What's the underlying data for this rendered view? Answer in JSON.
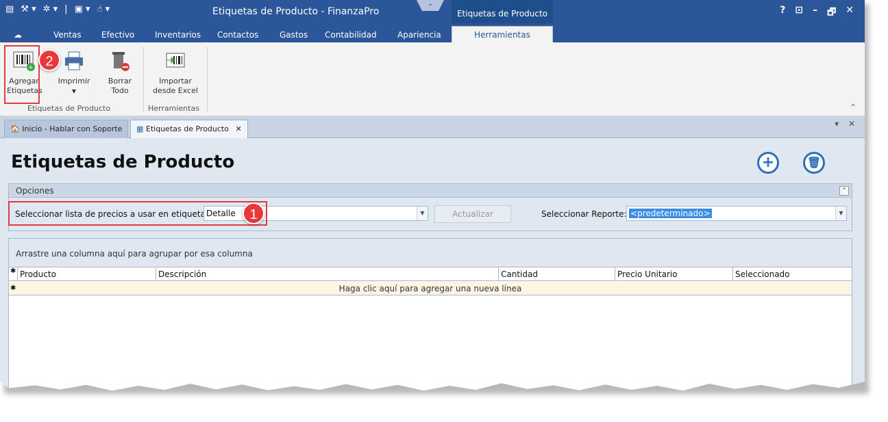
{
  "window": {
    "title": "Etiquetas de Producto - FinanzaPro",
    "context_tab": "Etiquetas de Producto",
    "controls": [
      "?",
      "⊡",
      "–",
      "🗗",
      "✕"
    ]
  },
  "ribbon_tabs": [
    "Ventas",
    "Efectivo",
    "Inventarios",
    "Contactos",
    "Gastos",
    "Contabilidad",
    "Apariencia",
    "Herramientas"
  ],
  "ribbon": {
    "buttons": {
      "agregar": "Agregar\nEtiquetas",
      "imprimir": "Imprimir",
      "borrar": "Borrar\nTodo",
      "importar": "Importar\ndesde Excel"
    },
    "groups": {
      "etiquetas": "Etiquetas de Producto",
      "herramientas": "Herramientas"
    }
  },
  "doc_tabs": {
    "home": "Inicio - Hablar con Soporte",
    "current": "Etiquetas de Producto"
  },
  "page": {
    "title": "Etiquetas de Producto"
  },
  "options": {
    "header": "Opciones",
    "price_list_label": "Seleccionar lista de precios a usar en etiquetas:",
    "price_list_value": "Detalle",
    "update_button": "Actualizar",
    "report_label": "Seleccionar Reporte:",
    "report_value": "<predeterminado>"
  },
  "grid": {
    "group_hint": "Arrastre una columna aquí para agrupar por esa columna",
    "columns": [
      "Producto",
      "Descripción",
      "Cantidad",
      "Precio Unitario",
      "Seleccionado"
    ],
    "new_row_hint": "Haga clic aquí para agregar una nueva línea"
  },
  "callouts": [
    "1",
    "2"
  ],
  "colors": {
    "titlebar": "#2b579a",
    "callout": "#e8393a",
    "accent": "#2f6fb5"
  }
}
